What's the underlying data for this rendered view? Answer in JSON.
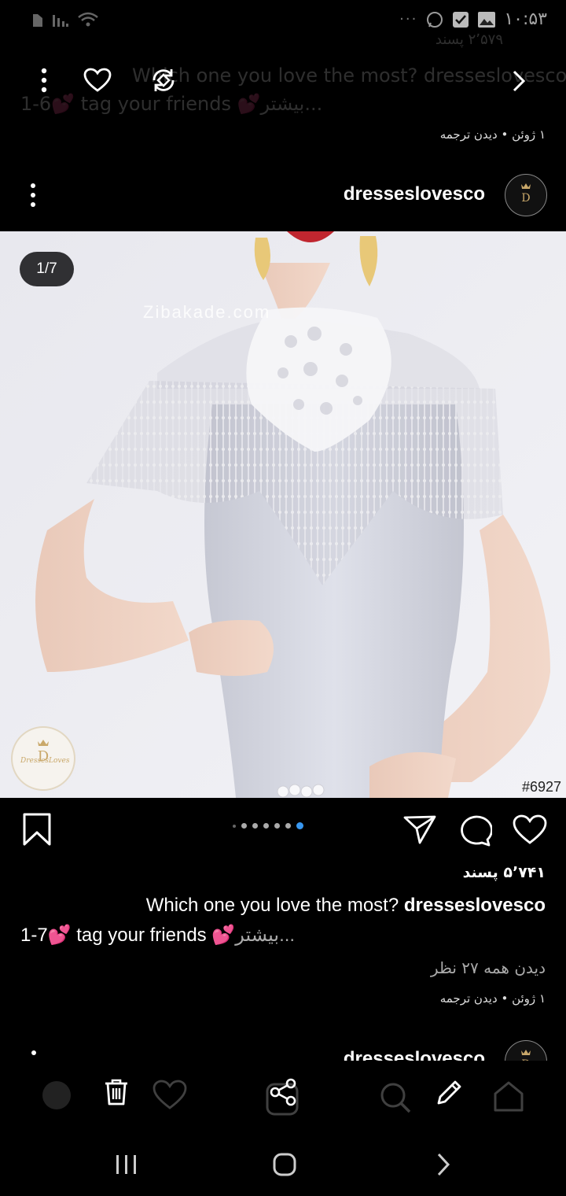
{
  "status_bar": {
    "time": "۱۰:۵۳"
  },
  "previous_post": {
    "likes_partial": "۲٬۵۷۹ پسند",
    "caption_line1": "Which one you love the most? dresseslovesco",
    "caption_line2": "1-6💕 tag your friends 💕بیشتر...",
    "date": "۱ ژوئن",
    "translate": "دیدن ترجمه",
    "separator": "•"
  },
  "post": {
    "username": "dresseslovesco",
    "avatar_text": "DressesLoves",
    "carousel_counter": "1/7",
    "watermark": "Zibakade.com",
    "image_tag": "#6927",
    "logo_text": "DressesLoves",
    "likes": "۵٬۷۴۱ پسند",
    "caption": {
      "question": "Which one you love the most?",
      "username": "dresseslovesco",
      "line2_start": "1-7",
      "line2_mid": "tag your friends",
      "more": "بیشتر..."
    },
    "view_comments": "دیدن همه ۲۷ نظر",
    "date": "۱ ژوئن",
    "separator": "•",
    "translate": "دیدن ترجمه"
  },
  "next_post": {
    "username": "dresseslovesco"
  }
}
